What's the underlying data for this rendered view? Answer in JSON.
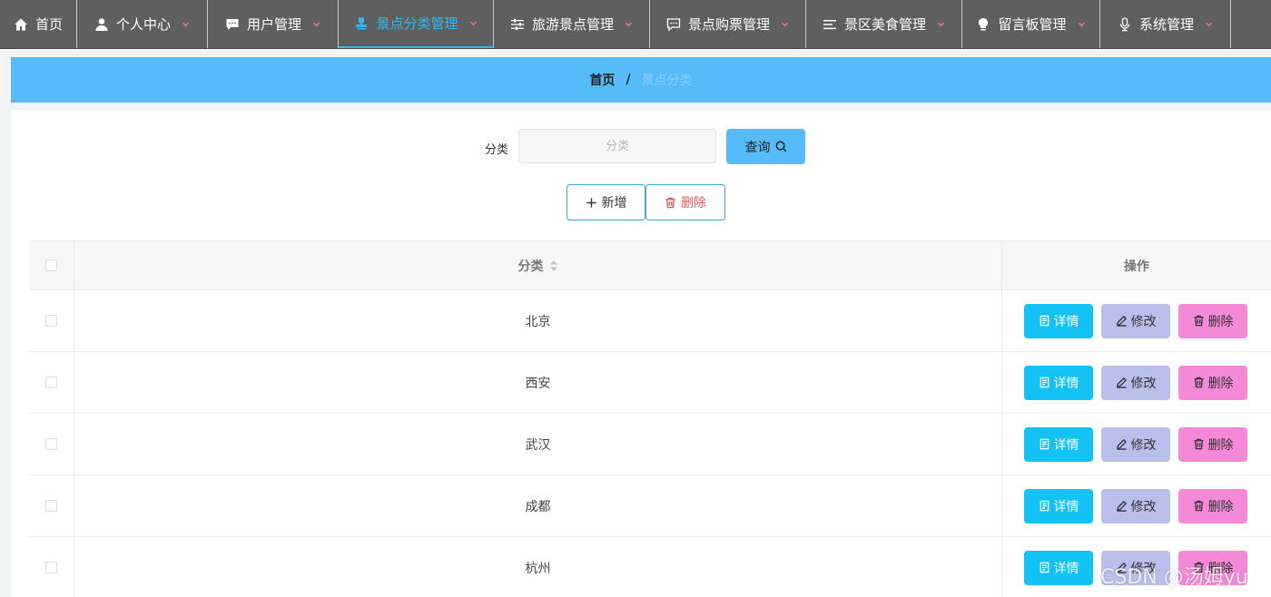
{
  "nav": {
    "items": [
      {
        "label": "首页",
        "icon": "home-icon",
        "has_dropdown": false
      },
      {
        "label": "个人中心",
        "icon": "user-icon",
        "has_dropdown": true
      },
      {
        "label": "用户管理",
        "icon": "chat-icon",
        "has_dropdown": true
      },
      {
        "label": "景点分类管理",
        "icon": "stamp-icon",
        "has_dropdown": true,
        "active": true
      },
      {
        "label": "旅游景点管理",
        "icon": "sliders-icon",
        "has_dropdown": true
      },
      {
        "label": "景点购票管理",
        "icon": "message-icon",
        "has_dropdown": true
      },
      {
        "label": "景区美食管理",
        "icon": "list-icon",
        "has_dropdown": true
      },
      {
        "label": "留言板管理",
        "icon": "bulb-icon",
        "has_dropdown": true
      },
      {
        "label": "系统管理",
        "icon": "mic-icon",
        "has_dropdown": true
      }
    ]
  },
  "breadcrumb": {
    "home": "首页",
    "separator": "/",
    "current": "景点分类"
  },
  "search": {
    "label": "分类",
    "placeholder": "分类",
    "value": "",
    "query_label": "查询"
  },
  "actions": {
    "add_label": "新增",
    "delete_label": "删除"
  },
  "table": {
    "columns": {
      "category": "分类",
      "operations": "操作"
    },
    "rows": [
      {
        "category": "北京"
      },
      {
        "category": "西安"
      },
      {
        "category": "武汉"
      },
      {
        "category": "成都"
      },
      {
        "category": "杭州"
      }
    ],
    "row_actions": {
      "detail": "详情",
      "edit": "修改",
      "delete": "删除"
    }
  },
  "colors": {
    "nav_bg": "#5f5f5f",
    "accent": "#55bbf9",
    "active_nav": "#33b8f0",
    "detail_btn": "#13c2f5",
    "edit_btn": "#b8bfeb",
    "delete_btn": "#f589d7",
    "caret": "#e9738a"
  },
  "watermark": "CSDN @汤姆yu"
}
